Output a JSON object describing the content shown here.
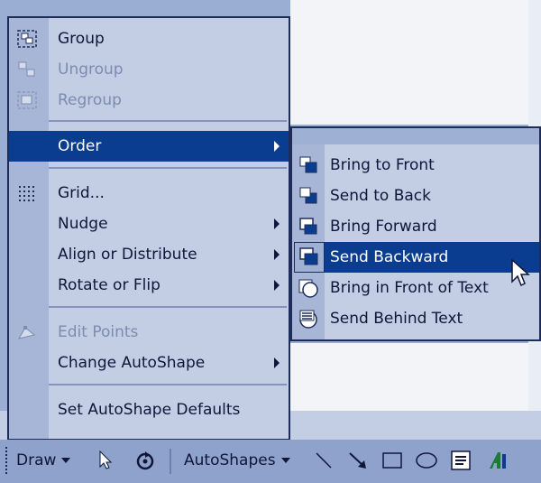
{
  "main_menu": {
    "items": [
      {
        "label": "Group",
        "enabled": true,
        "icon": "group-icon"
      },
      {
        "label": "Ungroup",
        "enabled": false,
        "icon": "ungroup-icon"
      },
      {
        "label": "Regroup",
        "enabled": false,
        "icon": "regroup-icon"
      },
      {
        "label": "Order",
        "enabled": true,
        "highlighted": true,
        "submenu": true
      },
      {
        "label": "Grid...",
        "enabled": true,
        "icon": "grid-icon"
      },
      {
        "label": "Nudge",
        "enabled": true,
        "submenu": true
      },
      {
        "label": "Align or Distribute",
        "enabled": true,
        "submenu": true
      },
      {
        "label": "Rotate or Flip",
        "enabled": true,
        "submenu": true
      },
      {
        "label": "Edit Points",
        "enabled": false,
        "icon": "edit-points-icon"
      },
      {
        "label": "Change AutoShape",
        "enabled": true,
        "submenu": true
      },
      {
        "label": "Set AutoShape Defaults",
        "enabled": true
      }
    ]
  },
  "order_submenu": {
    "items": [
      {
        "label": "Bring to Front",
        "icon": "bring-to-front-icon"
      },
      {
        "label": "Send to Back",
        "icon": "send-to-back-icon"
      },
      {
        "label": "Bring Forward",
        "icon": "bring-forward-icon"
      },
      {
        "label": "Send Backward",
        "icon": "send-backward-icon",
        "highlighted": true
      },
      {
        "label": "Bring in Front of Text",
        "icon": "bring-in-front-of-text-icon"
      },
      {
        "label": "Send Behind Text",
        "icon": "send-behind-text-icon"
      }
    ]
  },
  "toolbar": {
    "draw_label": "Draw",
    "autoshapes_label": "AutoShapes",
    "buttons": [
      "select-objects-icon",
      "free-rotate-icon",
      "line-icon",
      "arrow-icon",
      "rectangle-icon",
      "oval-icon",
      "text-box-icon",
      "wordart-icon"
    ]
  },
  "colors": {
    "highlight": "#0a3c8f",
    "menu_bg": "#c3cde4",
    "disabled_text": "#7d8bb0"
  }
}
